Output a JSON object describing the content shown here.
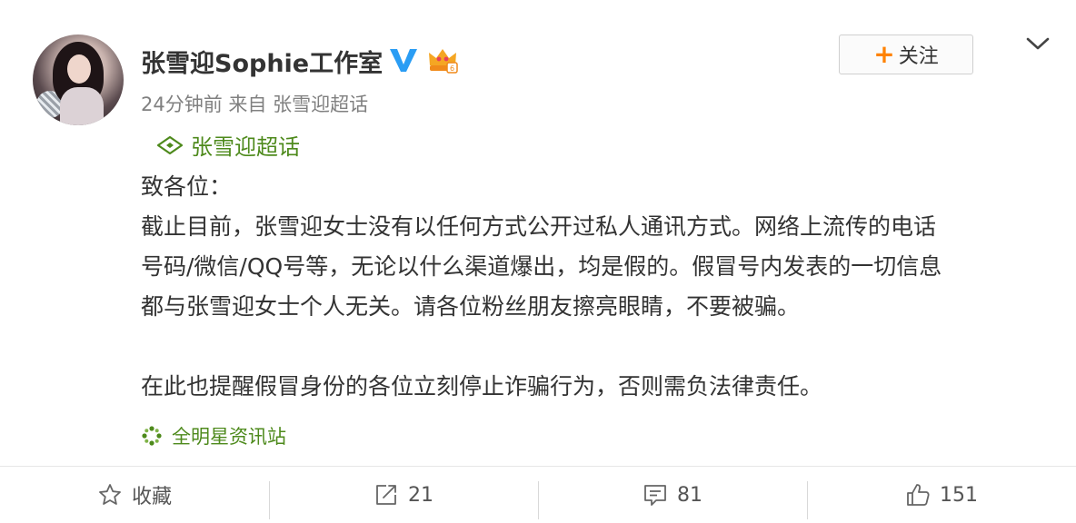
{
  "post": {
    "author": "张雪迎Sophie工作室",
    "time": "24分钟前",
    "source_prefix": "来自",
    "source_app": "张雪迎超话",
    "follow_label": "关注",
    "topic": "张雪迎超话",
    "lines": [
      "致各位：",
      "截止目前，张雪迎女士没有以任何方式公开过私人通讯方式。网络上流传的电话",
      "号码/微信/QQ号等，无论以什么渠道爆出，均是假的。假冒号内发表的一切信息",
      "都与张雪迎女士个人无关。请各位粉丝朋友擦亮眼睛，不要被骗。",
      "",
      "在此也提醒假冒身份的各位立刻停止诈骗行为，否则需负法律责任。"
    ],
    "via": "全明星资讯站"
  },
  "actions": {
    "favorite_label": "收藏",
    "repost_count": "21",
    "comment_count": "81",
    "like_count": "151"
  },
  "icons": {
    "verified": "verified-v-icon",
    "member": "crown-member-icon",
    "topic": "supertopic-diamond-icon",
    "via": "app-flower-icon",
    "favorite": "star-icon",
    "repost": "repost-arrow-icon",
    "comment": "comment-icon",
    "like": "thumbs-up-icon"
  },
  "colors": {
    "accent_orange": "#ff8200",
    "topic_green": "#4e8a1c",
    "verified_blue": "#2a9df4",
    "crown_orange": "#f5a623"
  }
}
